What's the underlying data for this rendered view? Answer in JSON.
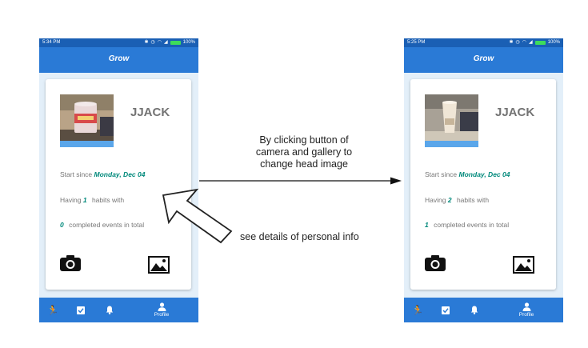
{
  "app_title": "Grow",
  "screens": [
    {
      "time": "5:34 PM",
      "battery": "100%",
      "username": "JJACK",
      "start_label": "Start since",
      "start_date": "Monday, Dec 04",
      "having_label": "Having",
      "habit_count": "1",
      "habits_label": "habits with",
      "events_count": "0",
      "events_label": "completed events in total",
      "nav_profile": "Profile"
    },
    {
      "time": "5:25 PM",
      "battery": "100%",
      "username": "JJACK",
      "start_label": "Start since",
      "start_date": "Monday, Dec 04",
      "having_label": "Having",
      "habit_count": "2",
      "habits_label": "habits with",
      "events_count": "1",
      "events_label": "completed events in total",
      "nav_profile": "Profile"
    }
  ],
  "annotations": {
    "change_image_line1": "By clicking button of",
    "change_image_line2": "camera and gallery to",
    "change_image_line3": "change head image",
    "details": "see details of personal info"
  },
  "icons": {
    "nav": [
      "running-icon",
      "check-box-icon",
      "bell-icon",
      "person-icon"
    ],
    "card": [
      "camera-icon",
      "gallery-icon"
    ]
  },
  "colors": {
    "status_bar": "#1a5fb4",
    "app_bar": "#2a7ad6",
    "accent_text": "#00897b",
    "photo_frame": "#5aa6ea"
  }
}
